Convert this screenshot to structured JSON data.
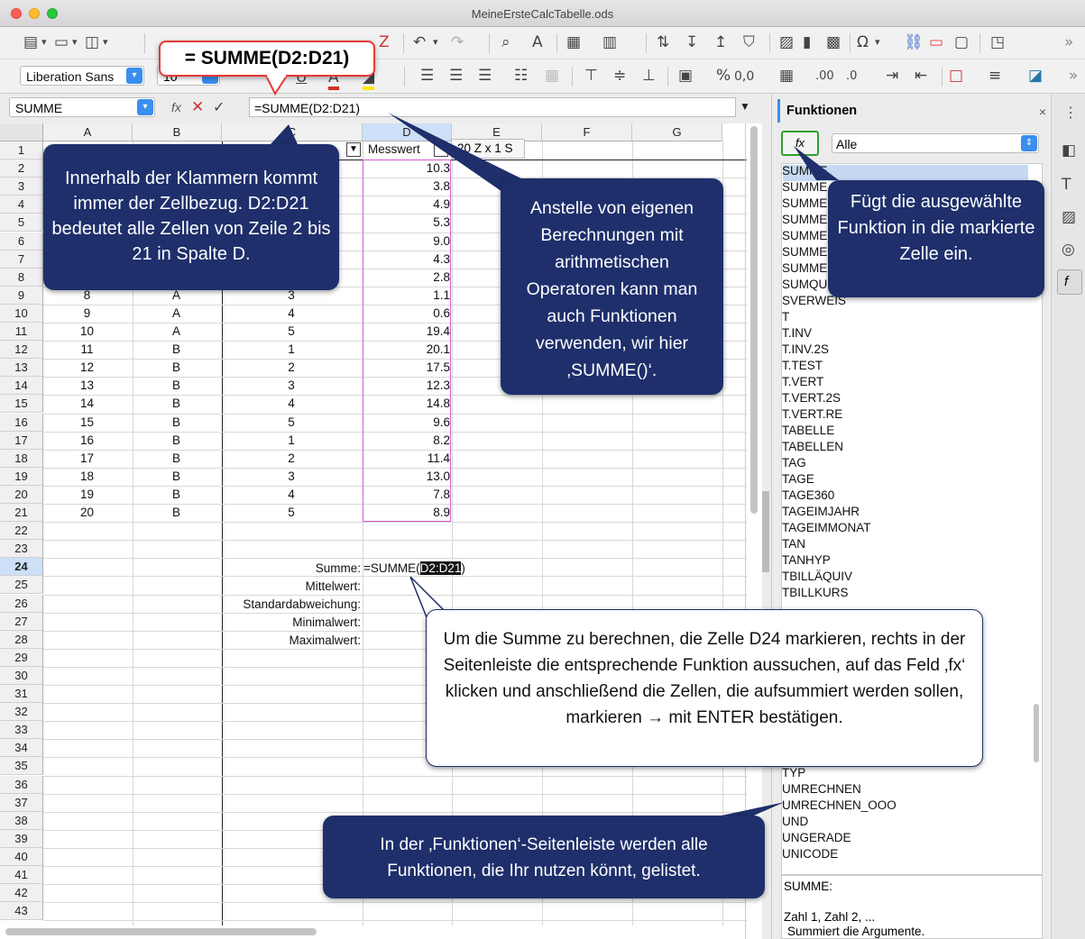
{
  "window": {
    "title": "MeineErsteCalcTabelle.ods"
  },
  "toolbar": {
    "font_name": "Liberation Sans",
    "font_size": "10",
    "more": "»"
  },
  "formula_bar": {
    "name_box": "SUMME",
    "fx_label": "fx",
    "cancel": "✕",
    "accept": "✓",
    "formula": "=SUMME(D2:D21)",
    "expand": "▼"
  },
  "columns": [
    "A",
    "B",
    "C",
    "D",
    "E",
    "F",
    "G"
  ],
  "header_row": {
    "d": "Messwert",
    "tooltip": "20 Z x 1 S"
  },
  "rows": [
    {
      "a": "",
      "b": "",
      "c": "",
      "d": "10.3"
    },
    {
      "a": "",
      "b": "",
      "c": "",
      "d": "3.8"
    },
    {
      "a": "",
      "b": "",
      "c": "",
      "d": "4.9"
    },
    {
      "a": "",
      "b": "",
      "c": "",
      "d": "5.3"
    },
    {
      "a": "",
      "b": "",
      "c": "",
      "d": "9.0"
    },
    {
      "a": "",
      "b": "",
      "c": "",
      "d": "4.3"
    },
    {
      "a": "",
      "b": "",
      "c": "",
      "d": "2.8"
    },
    {
      "a": "8",
      "b": "A",
      "c": "3",
      "d": "1.1"
    },
    {
      "a": "9",
      "b": "A",
      "c": "4",
      "d": "0.6"
    },
    {
      "a": "10",
      "b": "A",
      "c": "5",
      "d": "19.4"
    },
    {
      "a": "11",
      "b": "B",
      "c": "1",
      "d": "20.1"
    },
    {
      "a": "12",
      "b": "B",
      "c": "2",
      "d": "17.5"
    },
    {
      "a": "13",
      "b": "B",
      "c": "3",
      "d": "12.3"
    },
    {
      "a": "14",
      "b": "B",
      "c": "4",
      "d": "14.8"
    },
    {
      "a": "15",
      "b": "B",
      "c": "5",
      "d": "9.6"
    },
    {
      "a": "16",
      "b": "B",
      "c": "1",
      "d": "8.2"
    },
    {
      "a": "17",
      "b": "B",
      "c": "2",
      "d": "11.4"
    },
    {
      "a": "18",
      "b": "B",
      "c": "3",
      "d": "13.0"
    },
    {
      "a": "19",
      "b": "B",
      "c": "4",
      "d": "7.8"
    },
    {
      "a": "20",
      "b": "B",
      "c": "5",
      "d": "8.9"
    }
  ],
  "stats": {
    "summe_label": "Summe:",
    "summe_formula_pre": "=SUMME(",
    "summe_formula_ref": "D2:D21",
    "summe_formula_post": ")",
    "mittelwert": "Mittelwert:",
    "stdabw": "Standardabweichung:",
    "min": "Minimalwert:",
    "max": "Maximalwert:"
  },
  "sidebar": {
    "title": "Funktionen",
    "close": "×",
    "menu": "⋮",
    "fx_button": "fx",
    "category": "Alle",
    "functions_top": [
      "SUMME",
      "SUMME",
      "SUMME",
      "SUMME",
      "SUMME",
      "SUMME",
      "SUMME",
      "SUMQU",
      "SVERWEIS",
      "T",
      "T.INV",
      "T.INV.2S",
      "T.TEST",
      "T.VERT",
      "T.VERT.2S",
      "T.VERT.RE",
      "TABELLE",
      "TABELLEN",
      "TAG",
      "TAGE",
      "TAGE360",
      "TAGEIMJAHR",
      "TAGEIMMONAT",
      "TAN",
      "TANHYP",
      "TBILLÄQUIV",
      "TBILLKURS"
    ],
    "functions_bottom": [
      "TYP",
      "UMRECHNEN",
      "UMRECHNEN_OOO",
      "UND",
      "UNGERADE",
      "UNICODE"
    ],
    "desc_name": "SUMME:",
    "desc_args": "Zahl 1, Zahl 2, ...",
    "desc_text": "Summiert die Argumente."
  },
  "callouts": {
    "formula": "= SUMME(D2:D21)",
    "klammern": "Innerhalb der Klammern kommt immer der Zellbezug. D2:D21 bedeutet alle Zellen von Zeile 2 bis 21 in Spalte D.",
    "anstelle": "Anstelle von eigenen Berechnungen mit arithmetischen Operatoren kann man auch Funktionen verwenden, wir hier ‚SUMME()‘.",
    "fuegt": "Fügt die ausgewählte Funktion in die markierte Zelle ein.",
    "summe_berechnen": "Um die Summe zu berechnen, die Zelle D24 markieren, rechts in der Seitenleiste die entsprechende Funktion aussuchen, auf das Feld ‚fx‘ klicken und anschließend die Zellen, die aufsummiert werden sollen, markieren → mit ENTER bestätigen.",
    "seitenleiste": "In der ‚Funktionen‘-Seitenleiste werden alle Funktionen, die Ihr nutzen könnt, gelistet."
  }
}
